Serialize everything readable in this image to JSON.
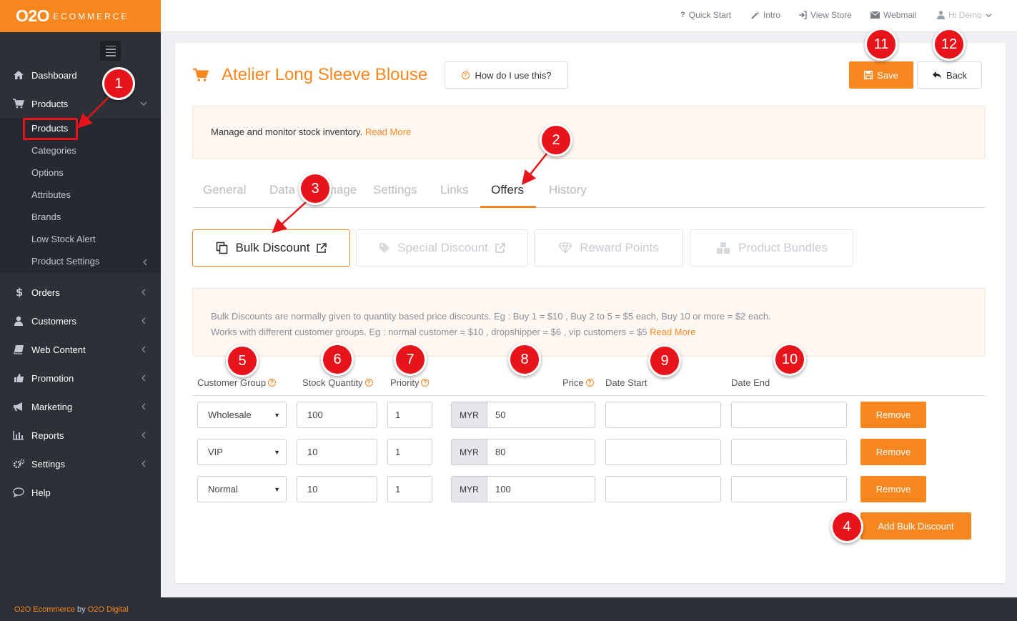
{
  "logo": {
    "brand": "O2O",
    "sub": "ECOMMERCE"
  },
  "topbar": {
    "links": [
      {
        "label": "Quick Start",
        "icon": "question-icon"
      },
      {
        "label": "Intro",
        "icon": "magic-wand-icon"
      },
      {
        "label": "View Store",
        "icon": "sign-in-icon"
      },
      {
        "label": "Webmail",
        "icon": "envelope-icon"
      }
    ],
    "user": "Hi Demo"
  },
  "sidebar": {
    "items": [
      {
        "label": "Dashboard",
        "icon": "home-icon"
      },
      {
        "label": "Products",
        "icon": "cart-icon"
      },
      {
        "label": "Orders",
        "icon": "dollar-icon"
      },
      {
        "label": "Customers",
        "icon": "user-icon"
      },
      {
        "label": "Web Content",
        "icon": "book-icon"
      },
      {
        "label": "Promotion",
        "icon": "thumbs-up-icon"
      },
      {
        "label": "Marketing",
        "icon": "bullhorn-icon"
      },
      {
        "label": "Reports",
        "icon": "bar-chart-icon"
      },
      {
        "label": "Settings",
        "icon": "cogs-icon"
      },
      {
        "label": "Help",
        "icon": "comment-icon"
      }
    ],
    "products_sub": [
      "Products",
      "Categories",
      "Options",
      "Attributes",
      "Brands",
      "Low Stock Alert",
      "Product Settings"
    ]
  },
  "page": {
    "title": "Atelier Long Sleeve Blouse",
    "help_button": "How do I use this?",
    "save": "Save",
    "back": "Back",
    "notice_text": "Manage and monitor stock inventory.",
    "read_more": "Read More"
  },
  "tabs": {
    "items": [
      "General",
      "Data",
      "Image",
      "Settings",
      "Links",
      "Offers",
      "History"
    ],
    "active": "Offers"
  },
  "discount_tabs": [
    {
      "label": "Bulk Discount",
      "icon": "copy-icon",
      "active": true
    },
    {
      "label": "Special Discount",
      "icon": "tag-icon",
      "active": false
    },
    {
      "label": "Reward Points",
      "icon": "diamond-icon",
      "active": false
    },
    {
      "label": "Product Bundles",
      "icon": "cubes-icon",
      "active": false
    }
  ],
  "bulk_info": {
    "line1": "Bulk Discounts are normally given to quantity based price discounts. Eg : Buy 1 = $10 , Buy 2 to 5 = $5 each, Buy 10 or more = $2 each.",
    "line2": "Works with different customer groups. Eg : normal customer = $10 , dropshipper = $6 , vip customers = $5",
    "read_more": "Read More"
  },
  "table": {
    "headers": {
      "group": "Customer Group",
      "qty": "Stock Quantity",
      "priority": "Priority",
      "price": "Price",
      "start": "Date Start",
      "end": "Date End"
    },
    "rows": [
      {
        "group": "Wholesale",
        "qty": "100",
        "priority": "1",
        "currency": "MYR",
        "price": "50",
        "start": "",
        "end": "",
        "remove": "Remove"
      },
      {
        "group": "VIP",
        "qty": "10",
        "priority": "1",
        "currency": "MYR",
        "price": "80",
        "start": "",
        "end": "",
        "remove": "Remove"
      },
      {
        "group": "Normal",
        "qty": "10",
        "priority": "1",
        "currency": "MYR",
        "price": "100",
        "start": "",
        "end": "",
        "remove": "Remove"
      }
    ],
    "add_button": "Add Bulk Discount"
  },
  "annotations": [
    "1",
    "2",
    "3",
    "4",
    "5",
    "6",
    "7",
    "8",
    "9",
    "10",
    "11",
    "12"
  ],
  "footer": {
    "brand": "O2O Ecommerce",
    "by": "by",
    "company": "O2O Digital"
  },
  "colors": {
    "accent": "#f7871e",
    "sidebar": "#2c3037",
    "annotation": "#e8141c"
  }
}
